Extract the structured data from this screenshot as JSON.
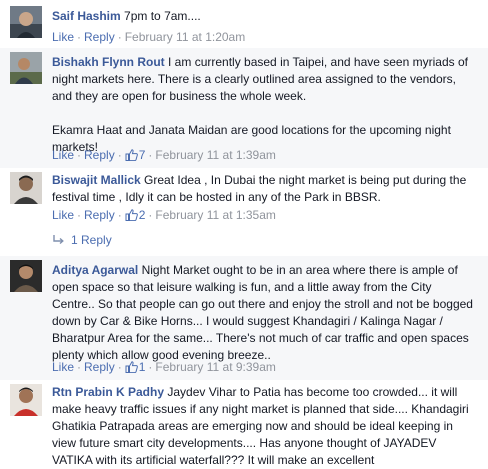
{
  "comments": [
    {
      "author": "Saif Hashim",
      "text": [
        "7pm to 7am...."
      ],
      "actions": {
        "like": "Like",
        "reply": "Reply",
        "likes": "",
        "timestamp": "February 11 at 1:20am"
      }
    },
    {
      "author": "Bishakh Flynn Rout",
      "text": [
        "I am currently based in Taipei, and have seen myriads of night markets here. There is a clearly outlined area assigned to the vendors, and they are open for business the whole week.",
        "Ekamra Haat and Janata Maidan are good locations for the upcoming night markets!"
      ],
      "actions": {
        "like": "Like",
        "reply": "Reply",
        "likes": "7",
        "timestamp": "February 11 at 1:39am"
      }
    },
    {
      "author": "Biswajit Mallick",
      "text": [
        "Great Idea , In Dubai the night market is being put during the festival time , Idly it can be hosted in any of the Park in BBSR."
      ],
      "actions": {
        "like": "Like",
        "reply": "Reply",
        "likes": "2",
        "timestamp": "February 11 at 1:35am"
      },
      "replies_label": "1 Reply"
    },
    {
      "author": "Aditya Agarwal",
      "text": [
        "Night Market ought to be in an area where there is ample of open space so that leisure walking is fun, and a little away from the City Centre.. So that people can go out there and enjoy the stroll and not be bogged down by Car & Bike Horns... I would suggest Khandagiri / Kalinga Nagar / Bharatpur Area for the same... There's not much of car traffic and open spaces plenty which allow good evening breeze.."
      ],
      "actions": {
        "like": "Like",
        "reply": "Reply",
        "likes": "1",
        "timestamp": "February 11 at 9:39am"
      }
    },
    {
      "author": "Rtn Prabin K Padhy",
      "text": [
        "Jaydev Vihar to Patia has become too crowded... it will make heavy traffic issues if any night market is planned that side.... Khandagiri Ghatikia Patrapada areas are emerging now and should be ideal keeping in view future smart city developments.... Has anyone thought of JAYADEV VATIKA with its artificial waterfall??? It will make an excellent"
      ]
    }
  ],
  "icons": {
    "like": "thumbs-up-icon",
    "reply": "reply-arrow-icon"
  },
  "colors": {
    "link": "#3b5998",
    "meta": "#90949c",
    "alt_background": "#f6f7f9"
  }
}
